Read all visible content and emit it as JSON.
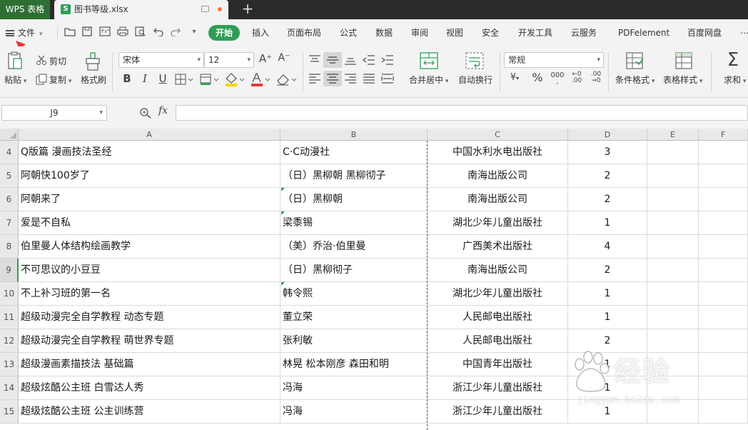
{
  "titlebar": {
    "app": "WPS 表格",
    "file_tab": "图书等级.xlsx",
    "file_icon": "S",
    "new_tab": "+"
  },
  "menu": {
    "file": "文件",
    "tabs": [
      "开始",
      "插入",
      "页面布局",
      "公式",
      "数据",
      "审阅",
      "视图",
      "安全",
      "开发工具",
      "云服务",
      "PDFelement",
      "百度网盘"
    ],
    "active_index": 0
  },
  "ribbon": {
    "paste": "粘贴",
    "cut": "剪切",
    "copy": "复制",
    "format_painter": "格式刷",
    "font_name": "宋体",
    "font_size": "12",
    "merge": "合并居中",
    "wrap": "自动换行",
    "number_format": "常规",
    "conditional_format": "条件格式",
    "table_style": "表格样式",
    "sum": "求和"
  },
  "formula_bar": {
    "name_box": "J9",
    "fx": "fx",
    "value": ""
  },
  "sheet": {
    "columns": [
      "A",
      "B",
      "C",
      "D",
      "E",
      "F"
    ],
    "rows": [
      {
        "num": "4",
        "a": "Q版篇 漫画技法圣经",
        "b": "C·C动漫社",
        "c": "中国水利水电出版社",
        "d": "3"
      },
      {
        "num": "5",
        "a": "阿朝快100岁了",
        "b": "（日）黑柳朝 黑柳彻子",
        "c": "南海出版公司",
        "d": "2"
      },
      {
        "num": "6",
        "a": "阿朝来了",
        "b": "（日）黑柳朝",
        "c": "南海出版公司",
        "d": "2"
      },
      {
        "num": "7",
        "a": "爱是不自私",
        "b": "梁黍锡",
        "c": "湖北少年儿童出版社",
        "d": "1"
      },
      {
        "num": "8",
        "a": "伯里曼人体结构绘画教学",
        "b": "（美）乔治·伯里曼",
        "c": "广西美术出版社",
        "d": "4"
      },
      {
        "num": "9",
        "a": "不可思议的小豆豆",
        "b": "（日）黑柳彻子",
        "c": "南海出版公司",
        "d": "2"
      },
      {
        "num": "10",
        "a": "不上补习班的第一名",
        "b": "韩令熙",
        "c": "湖北少年儿童出版社",
        "d": "1"
      },
      {
        "num": "11",
        "a": "超级动漫完全自学教程 动态专题",
        "b": "董立荣",
        "c": "人民邮电出版社",
        "d": "1"
      },
      {
        "num": "12",
        "a": "超级动漫完全自学教程 萌世界专题",
        "b": "张利敏",
        "c": "人民邮电出版社",
        "d": "2"
      },
      {
        "num": "13",
        "a": "超级漫画素描技法 基础篇",
        "b": "林晃 松本刚彦 森田和明",
        "c": "中国青年出版社",
        "d": "1"
      },
      {
        "num": "14",
        "a": "超级炫酷公主班 白雪达人秀",
        "b": "冯海",
        "c": "浙江少年儿童出版社",
        "d": "1"
      },
      {
        "num": "15",
        "a": "超级炫酷公主班 公主训练营",
        "b": "冯海",
        "c": "浙江少年儿童出版社",
        "d": "1"
      }
    ]
  },
  "watermark": {
    "brand": "经验",
    "url": "jingyan.baidu.com"
  },
  "colors": {
    "accent": "#2f9d57",
    "app_tab": "#2f6e33",
    "arrow": "#e53935"
  }
}
